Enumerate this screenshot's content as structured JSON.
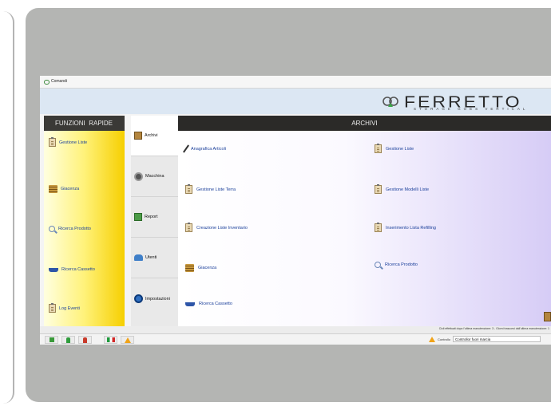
{
  "menu": {
    "comandi": "Comandi"
  },
  "logo": {
    "name": "FERRETTO",
    "tagline": "STORAGE GOES VERTICAL"
  },
  "quick": {
    "title": "FUNZIONI  RAPIDE",
    "items": [
      {
        "label": "Gestione Liste",
        "icon": "clipboard-icon"
      },
      {
        "label": "Giacenza",
        "icon": "stock-icon"
      },
      {
        "label": "Ricerca Prodotto",
        "icon": "search-icon"
      },
      {
        "label": "Ricerca Cassetto",
        "icon": "drawer-icon"
      },
      {
        "label": "Log Eventi",
        "icon": "log-icon"
      }
    ]
  },
  "tabs": [
    {
      "label": "Archivi",
      "icon": "archive-box-icon"
    },
    {
      "label": "Macchina",
      "icon": "machine-icon"
    },
    {
      "label": "Report",
      "icon": "report-icon"
    },
    {
      "label": "Utenti",
      "icon": "users-icon"
    },
    {
      "label": "Impostazioni",
      "icon": "settings-icon"
    }
  ],
  "main": {
    "title": "ARCHIVI",
    "left": [
      {
        "label": "Anagrafica Articoli",
        "icon": "pencil-icon"
      },
      {
        "label": "Gestione Liste Terra",
        "icon": "clipboard-icon"
      },
      {
        "label": "Creazione Liste Inventario",
        "icon": "clipboard-icon"
      },
      {
        "label": "Giacenza",
        "icon": "stock-icon"
      },
      {
        "label": "Ricerca Cassetto",
        "icon": "drawer-icon"
      }
    ],
    "right": [
      {
        "label": "Gestione Liste",
        "icon": "clipboard-icon"
      },
      {
        "label": "Gestione Modelli Liste",
        "icon": "clipboard-icon"
      },
      {
        "label": "Inserimento Lista Refilling",
        "icon": "clipboard-icon"
      },
      {
        "label": "Ricerca Prodotto",
        "icon": "search-icon"
      }
    ]
  },
  "status": {
    "text": "Cicli effettuati dopo l'ultima manutenzione: 3 - Giorni trascorsi dall'ultima manutenzione: 1"
  },
  "control": {
    "label": "Controllo",
    "value": "Controllor fuori marcia"
  },
  "colors": {
    "accent_yellow": "#f6cf00",
    "title_bar": "#2b2a28",
    "link_blue": "#1a3f9a",
    "device_gray": "#b4b5b3"
  }
}
